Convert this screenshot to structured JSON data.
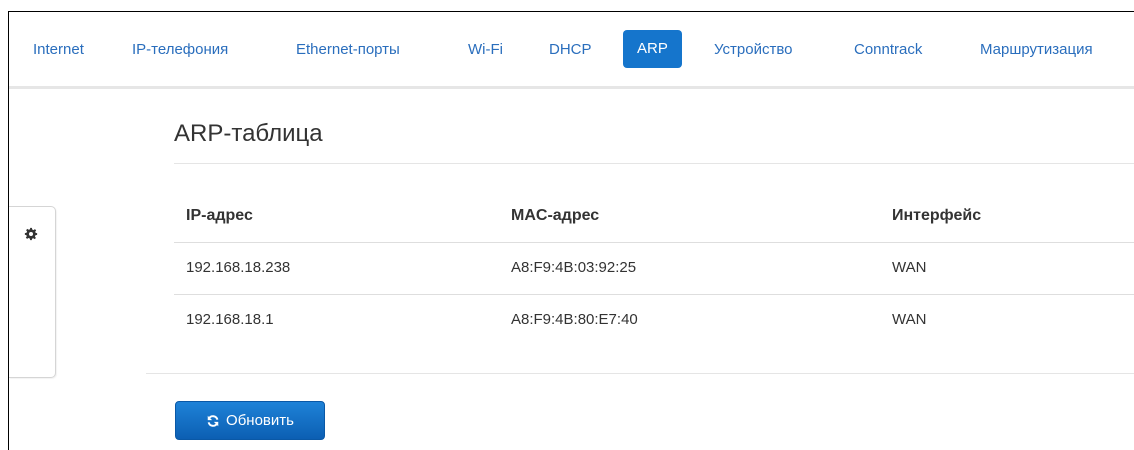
{
  "nav": {
    "tabs": [
      {
        "label": "Internet"
      },
      {
        "label": "IP-телефония"
      },
      {
        "label": "Ethernet-порты"
      },
      {
        "label": "Wi-Fi"
      },
      {
        "label": "DHCP"
      },
      {
        "label": "ARP"
      },
      {
        "label": "Устройство"
      },
      {
        "label": "Conntrack"
      },
      {
        "label": "Маршрутизация"
      }
    ],
    "active_tab": "ARP",
    "accent_color": "#1575cc"
  },
  "sidebar": {
    "icon": "gear-icon"
  },
  "panel": {
    "title": "ARP-таблица",
    "table": {
      "columns": [
        "IP-адрес",
        "MAC-адрес",
        "Интерфейс"
      ],
      "rows": [
        [
          "192.168.18.238",
          "A8:F9:4B:03:92:25",
          "WAN"
        ],
        [
          "192.168.18.1",
          "A8:F9:4B:80:E7:40",
          "WAN"
        ]
      ]
    },
    "refresh_button": {
      "label": "Обновить",
      "icon": "refresh-icon"
    }
  }
}
